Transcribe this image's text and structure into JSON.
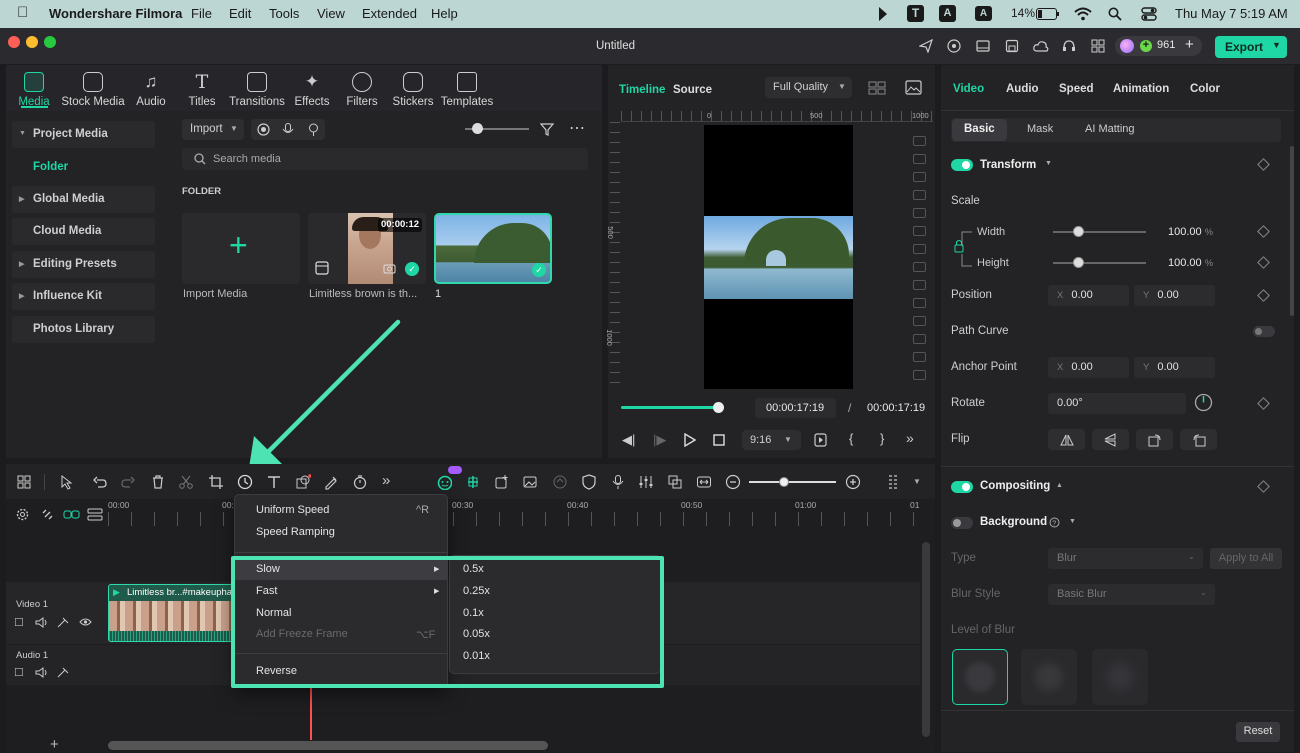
{
  "menubar": {
    "app": "Wondershare Filmora",
    "items": [
      "File",
      "Edit",
      "Tools",
      "View",
      "Extended",
      "Help"
    ],
    "battery": "14%",
    "datetime": "Thu May 7  5:19 AM"
  },
  "titlebar": {
    "title": "Untitled",
    "credits": "961",
    "export_label": "Export"
  },
  "media_tabs": [
    "Media",
    "Stock Media",
    "Audio",
    "Titles",
    "Transitions",
    "Effects",
    "Filters",
    "Stickers",
    "Templates"
  ],
  "sidebar": {
    "project_media": "Project Media",
    "folder": "Folder",
    "global_media": "Global Media",
    "cloud_media": "Cloud Media",
    "editing_presets": "Editing Presets",
    "influence_kit": "Influence Kit",
    "photos_library": "Photos Library"
  },
  "media_toolbar": {
    "import_label": "Import",
    "search_placeholder": "Search media",
    "folder_heading": "FOLDER"
  },
  "media_items": {
    "import_label": "Import Media",
    "clip1_label": "Limitless brown is th...",
    "clip1_duration": "00:00:12",
    "clip2_label": "1"
  },
  "preview": {
    "tab_timeline": "Timeline",
    "tab_source": "Source",
    "quality": "Full Quality",
    "ruler_marks": [
      "0",
      "500",
      "1000"
    ],
    "vruler_marks": [
      "500",
      "1000"
    ],
    "current_time": "00:00:17:19",
    "separator": "/",
    "total_time": "00:00:17:19",
    "aspect": "9:16",
    "playhead_progress": 1.0
  },
  "right_panel": {
    "tabs": [
      "Video",
      "Audio",
      "Speed",
      "Animation",
      "Color"
    ],
    "subtabs": [
      "Basic",
      "Mask",
      "AI Matting"
    ],
    "transform": "Transform",
    "scale": "Scale",
    "width_label": "Width",
    "width_value": "100.00",
    "height_label": "Height",
    "height_value": "100.00",
    "percent": "%",
    "position": "Position",
    "pos_x": "0.00",
    "pos_y": "0.00",
    "x_label": "X",
    "y_label": "Y",
    "path_curve": "Path Curve",
    "anchor_point": "Anchor Point",
    "anchor_x": "0.00",
    "anchor_y": "0.00",
    "rotate": "Rotate",
    "rotate_value": "0.00°",
    "flip": "Flip",
    "compositing": "Compositing",
    "background": "Background",
    "type_label": "Type",
    "type_value": "Blur",
    "apply_all": "Apply to All",
    "blur_style_label": "Blur Style",
    "blur_style_value": "Basic Blur",
    "level_of_blur": "Level of Blur",
    "reset": "Reset"
  },
  "timeline": {
    "ruler": [
      "00:00",
      "00:10",
      "00:30",
      "00:40",
      "00:50",
      "01:00",
      "01"
    ],
    "video_track": "Video 1",
    "audio_track": "Audio 1",
    "clip_label": "Limitless br...#makeupha"
  },
  "speed_menu": {
    "uniform_speed": "Uniform Speed",
    "uniform_shortcut": "^R",
    "speed_ramping": "Speed Ramping",
    "slow": "Slow",
    "fast": "Fast",
    "normal": "Normal",
    "freeze_frame": "Add Freeze Frame",
    "freeze_shortcut": "⌥F",
    "reverse": "Reverse",
    "submenu": [
      "0.5x",
      "0.25x",
      "0.1x",
      "0.05x",
      "0.01x"
    ]
  },
  "colors": {
    "accent": "#1fd6a5",
    "highlight": "#4ee3b3",
    "menubar": "#bcd6d4"
  }
}
